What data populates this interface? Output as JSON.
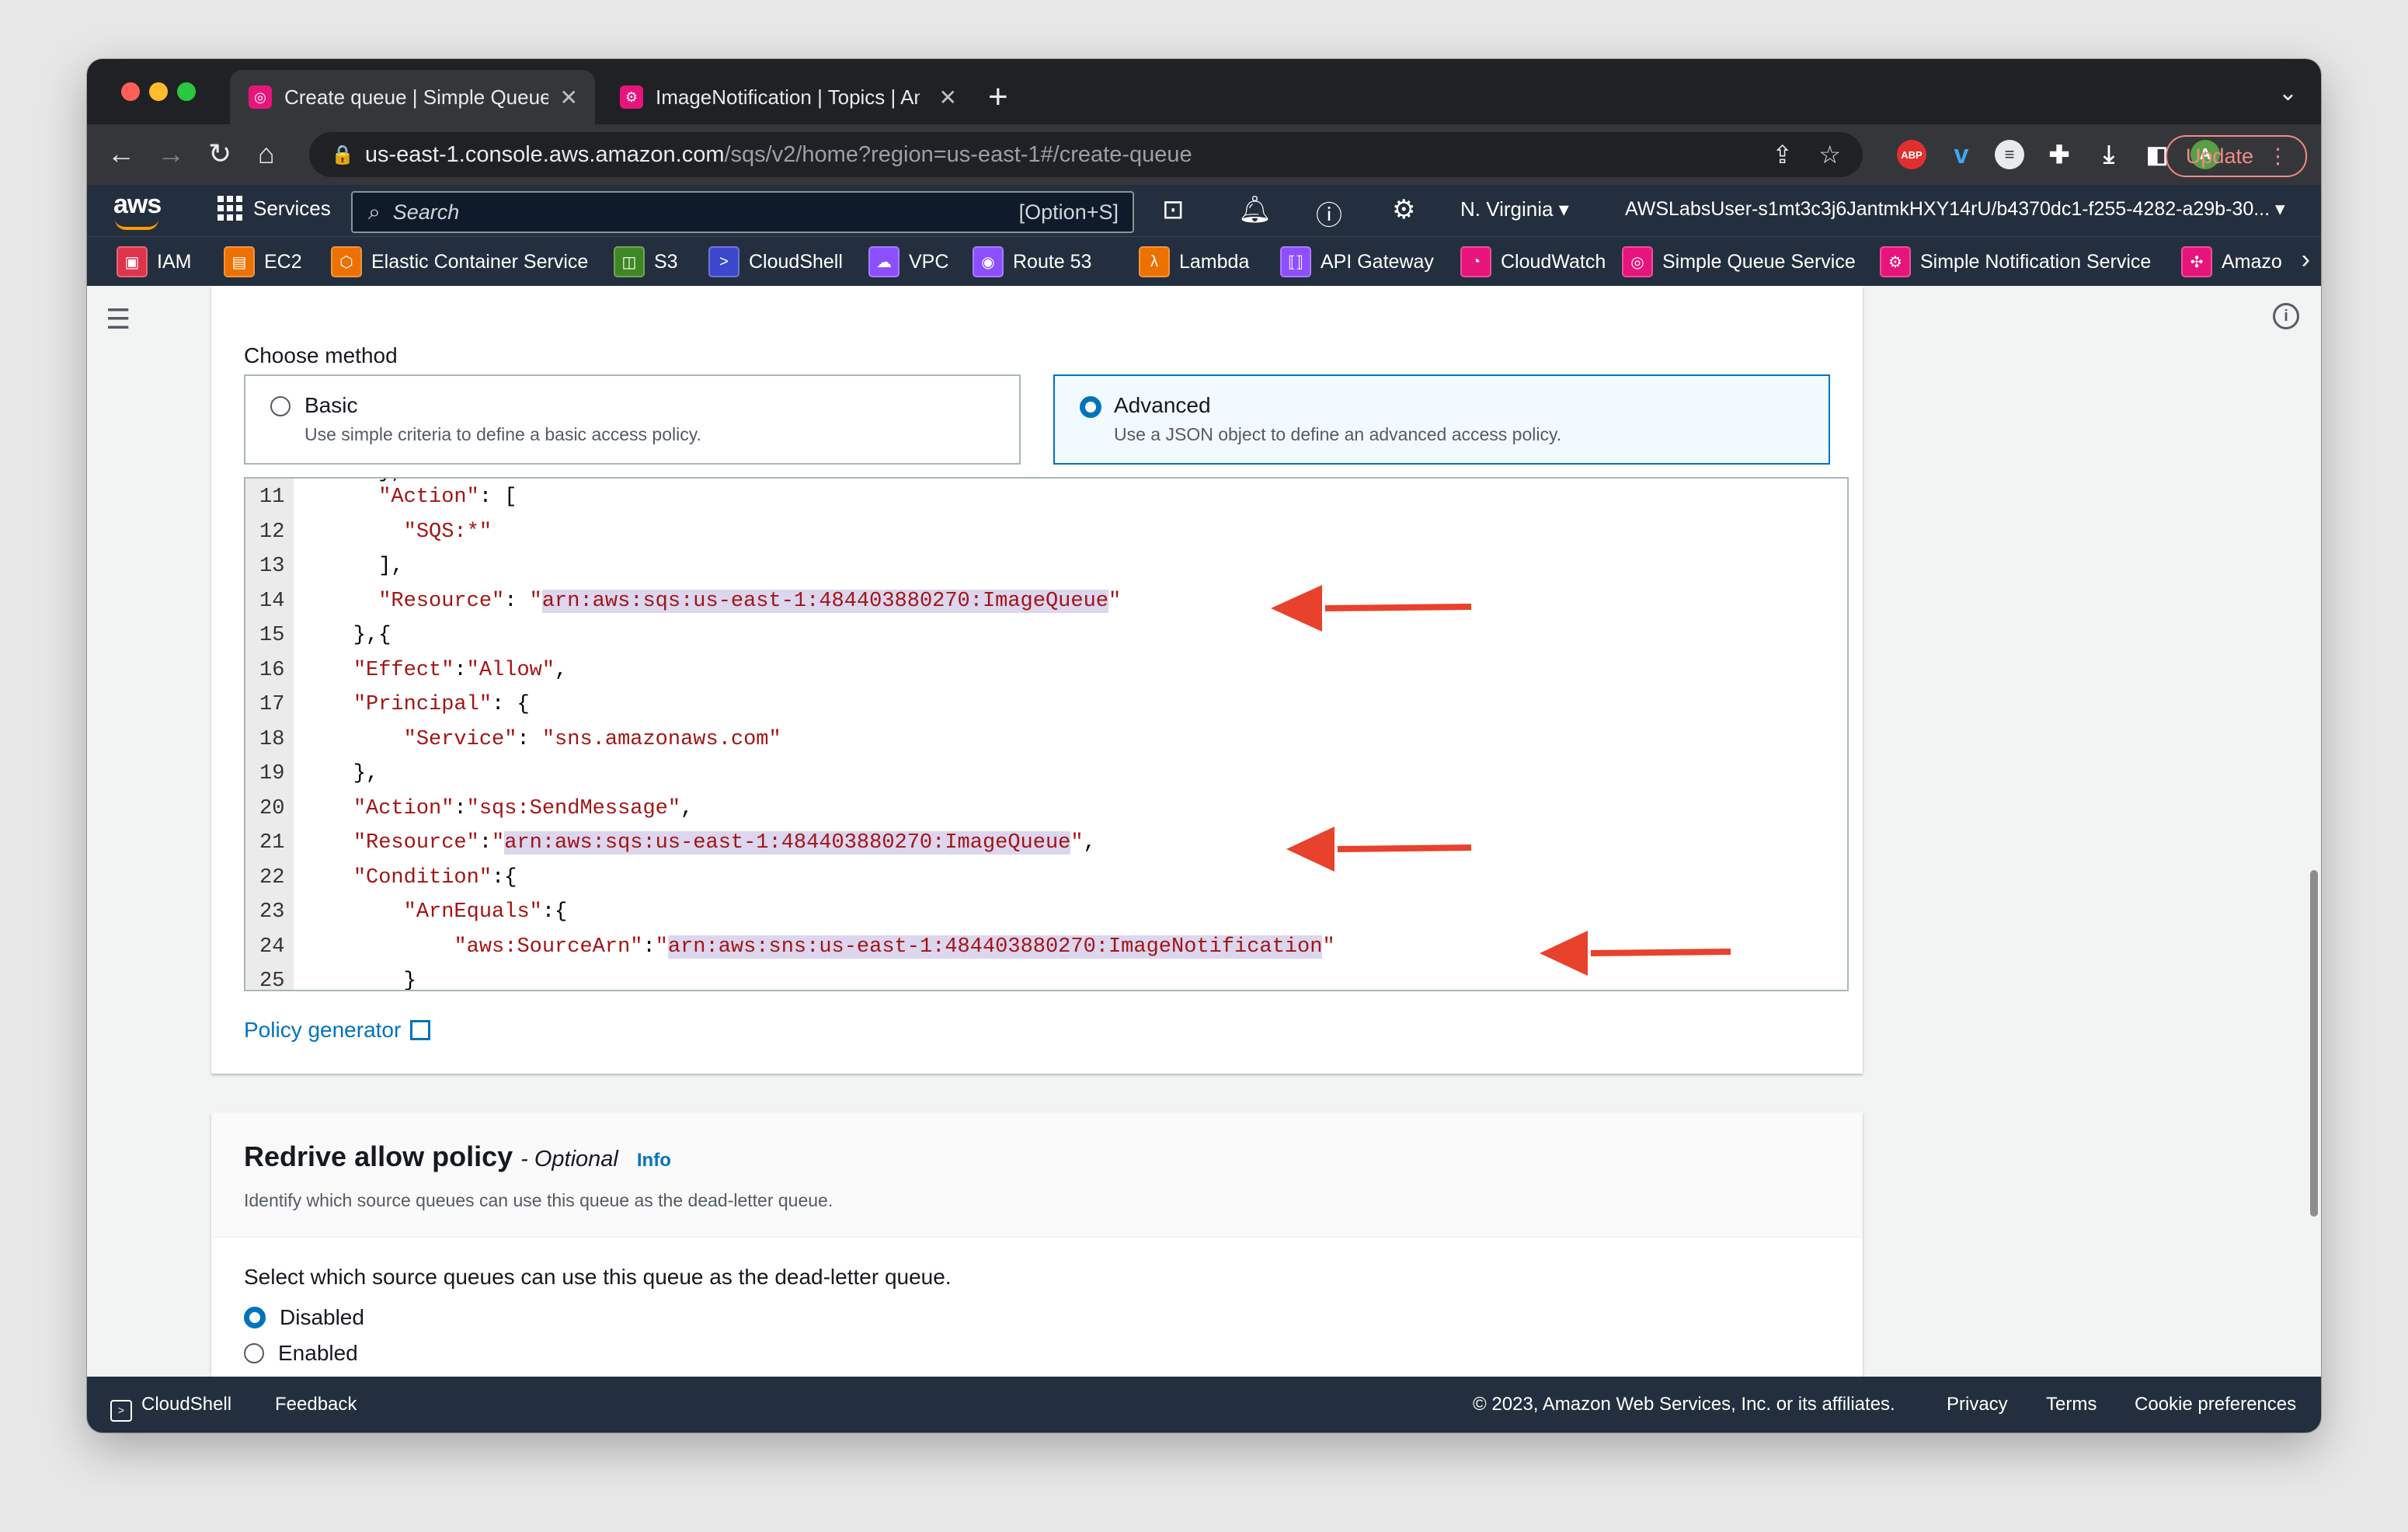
{
  "browser": {
    "tabs": [
      {
        "title": "Create queue | Simple Queue Service",
        "active": true
      },
      {
        "title": "ImageNotification | Topics | Amazon SNS",
        "active": false
      }
    ],
    "address": {
      "host": "us-east-1.console.aws.amazon.com",
      "path": "/sqs/v2/home?region=us-east-1#/create-queue"
    },
    "update_label": "Update",
    "profile_initial": "A",
    "abp_label": "ABP"
  },
  "aws_nav": {
    "logo": "aws",
    "services_label": "Services",
    "search_placeholder": "Search",
    "search_hint": "[Option+S]",
    "region": "N. Virginia",
    "account": "AWSLabsUser-s1mt3c3j6JantmkHXY14rU/b4370dc1-f255-4282-a29b-30..."
  },
  "favorites": [
    {
      "label": "IAM",
      "color": "#dd344c"
    },
    {
      "label": "EC2",
      "color": "#ed7100"
    },
    {
      "label": "Elastic Container Service",
      "color": "#ed7100"
    },
    {
      "label": "S3",
      "color": "#3f8624"
    },
    {
      "label": "CloudShell",
      "color": "#3b48cc"
    },
    {
      "label": "VPC",
      "color": "#8c4fff"
    },
    {
      "label": "Route 53",
      "color": "#8c4fff"
    },
    {
      "label": "Lambda",
      "color": "#ed7100"
    },
    {
      "label": "API Gateway",
      "color": "#8c4fff"
    },
    {
      "label": "CloudWatch",
      "color": "#e7157b"
    },
    {
      "label": "Simple Queue Service",
      "color": "#e7157b"
    },
    {
      "label": "Simple Notification Service",
      "color": "#e7157b"
    },
    {
      "label": "Amazon",
      "color": "#e7157b"
    }
  ],
  "access_policy": {
    "choose_method_label": "Choose method",
    "options": [
      {
        "title": "Basic",
        "desc": "Use simple criteria to define a basic access policy.",
        "selected": false
      },
      {
        "title": "Advanced",
        "desc": "Use a JSON object to define an advanced access policy.",
        "selected": true
      }
    ],
    "code_lines": [
      {
        "n": "11",
        "pre": "      \"Action\": [",
        "hl": "",
        "post": ""
      },
      {
        "n": "12",
        "pre": "        \"SQS:*\"",
        "hl": "",
        "post": ""
      },
      {
        "n": "13",
        "pre": "      ],",
        "hl": "",
        "post": ""
      },
      {
        "n": "14",
        "pre": "      \"Resource\": \"",
        "hl": "arn:aws:sqs:us-east-1:484403880270:ImageQueue",
        "post": "\""
      },
      {
        "n": "15",
        "pre": "    },{",
        "hl": "",
        "post": ""
      },
      {
        "n": "16",
        "pre": "    \"Effect\":\"Allow\",",
        "hl": "",
        "post": ""
      },
      {
        "n": "17",
        "pre": "    \"Principal\": {",
        "hl": "",
        "post": ""
      },
      {
        "n": "18",
        "pre": "        \"Service\": \"sns.amazonaws.com\"",
        "hl": "",
        "post": ""
      },
      {
        "n": "19",
        "pre": "    },",
        "hl": "",
        "post": ""
      },
      {
        "n": "20",
        "pre": "    \"Action\":\"sqs:SendMessage\",",
        "hl": "",
        "post": ""
      },
      {
        "n": "21",
        "pre": "    \"Resource\":\"",
        "hl": "arn:aws:sqs:us-east-1:484403880270:ImageQueue",
        "post": "\","
      },
      {
        "n": "22",
        "pre": "    \"Condition\":{",
        "hl": "",
        "post": ""
      },
      {
        "n": "23",
        "pre": "        \"ArnEquals\":{",
        "hl": "",
        "post": ""
      },
      {
        "n": "24",
        "pre": "            \"aws:SourceArn\":\"",
        "hl": "arn:aws:sns:us-east-1:484403880270:ImageNotification",
        "post": "\""
      },
      {
        "n": "25",
        "pre": "        }",
        "hl": "",
        "post": ""
      }
    ],
    "policy_generator_label": "Policy generator",
    "arrow_color": "#e8412c"
  },
  "redrive": {
    "title": "Redrive allow policy",
    "optional": "- Optional",
    "info": "Info",
    "description": "Identify which source queues can use this queue as the dead-letter queue.",
    "question": "Select which source queues can use this queue as the dead-letter queue.",
    "options": [
      {
        "label": "Disabled",
        "selected": true
      },
      {
        "label": "Enabled",
        "selected": false
      }
    ]
  },
  "footer": {
    "cloudshell": "CloudShell",
    "feedback": "Feedback",
    "copyright": "© 2023, Amazon Web Services, Inc. or its affiliates.",
    "privacy": "Privacy",
    "terms": "Terms",
    "cookies": "Cookie preferences"
  }
}
